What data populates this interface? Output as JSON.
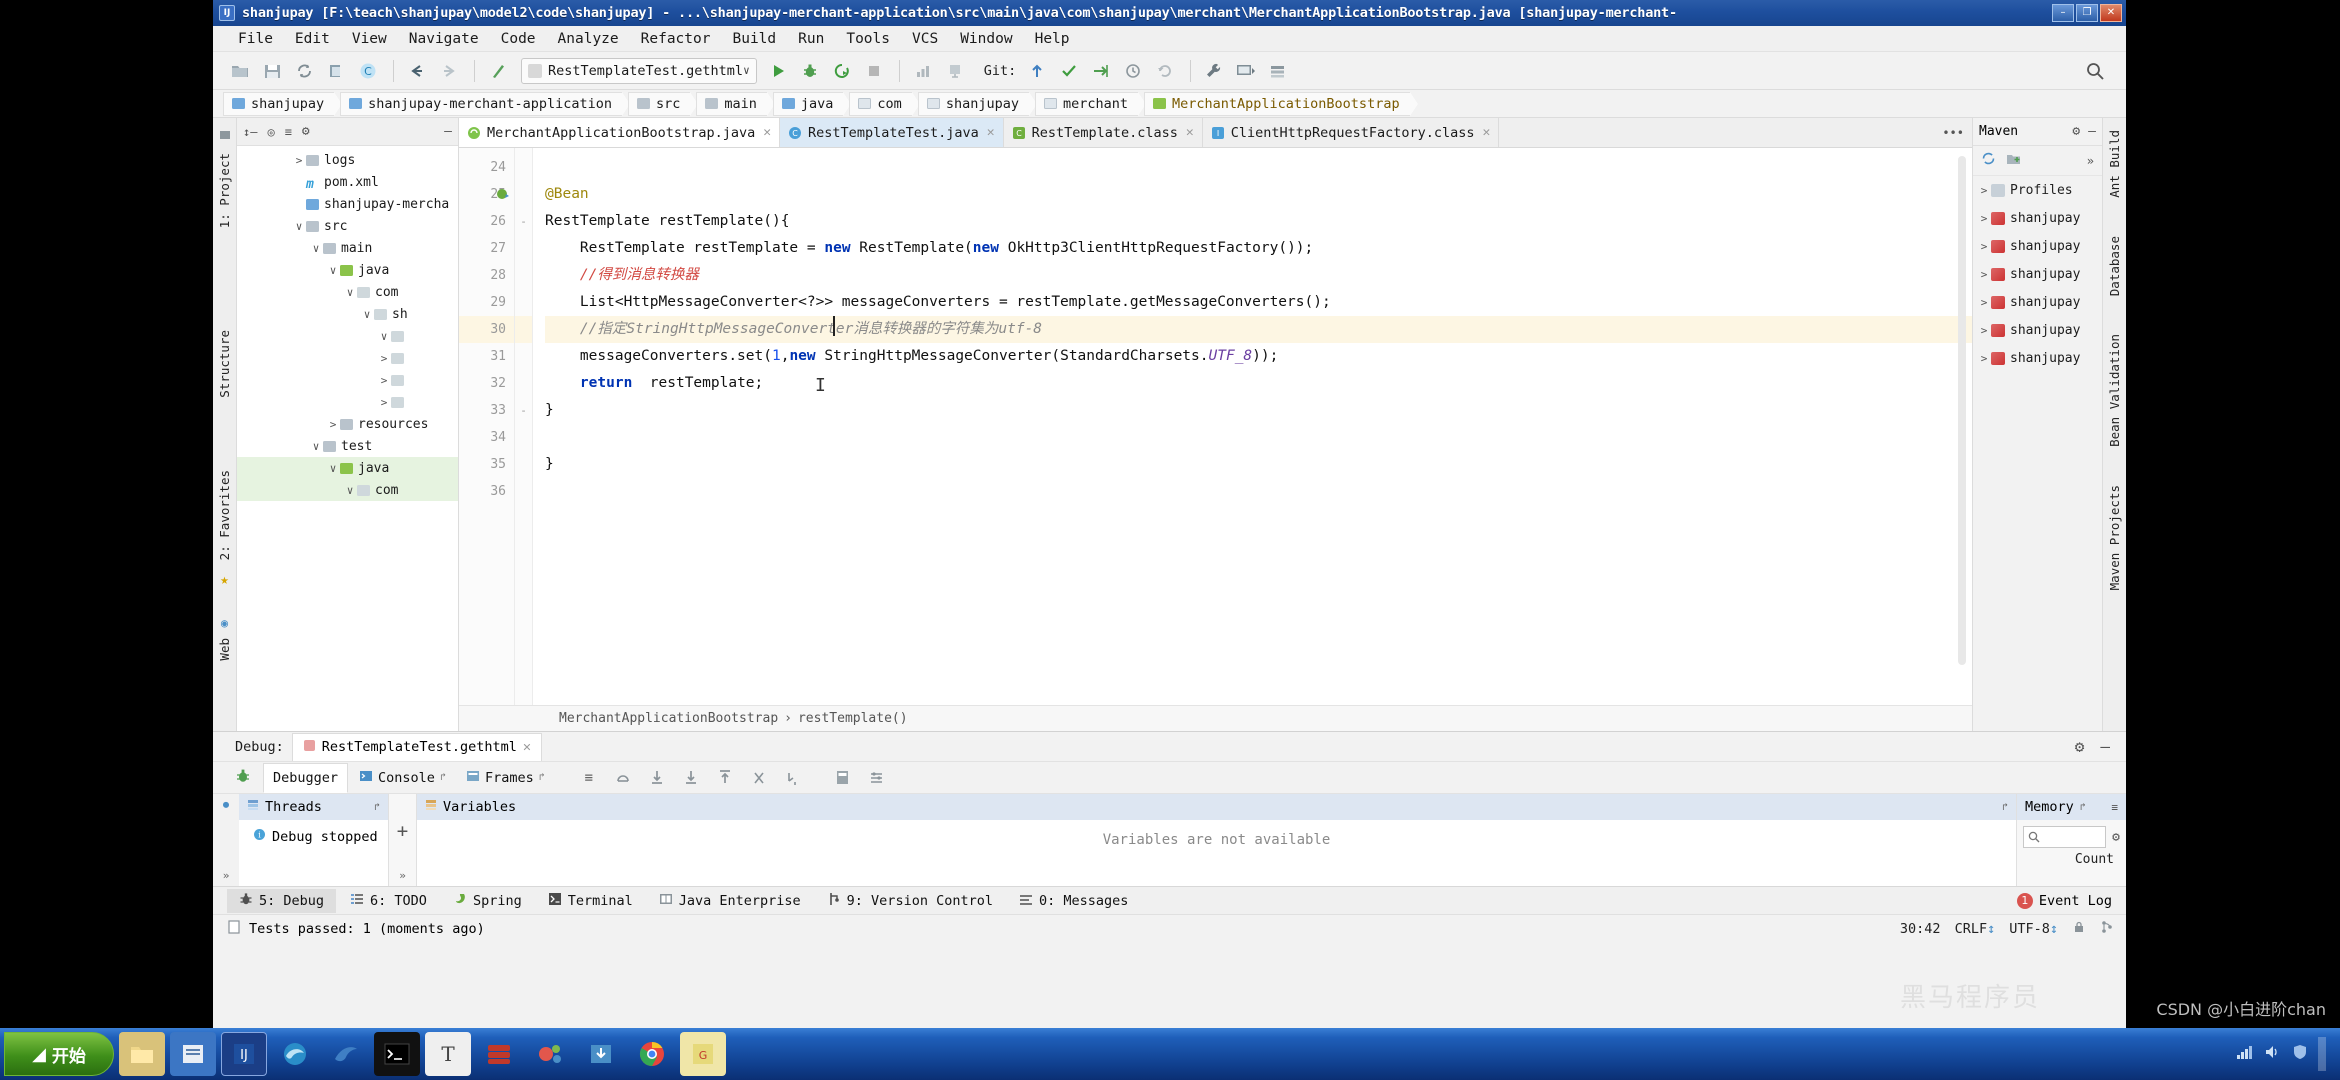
{
  "window": {
    "title": "shanjupay [F:\\teach\\shanjupay\\model2\\code\\shanjupay] - ...\\shanjupay-merchant-application\\src\\main\\java\\com\\shanjupay\\merchant\\MerchantApplicationBootstrap.java [shanjupay-merchant-",
    "app_icon": "idea-icon",
    "minimize": "–",
    "maximize": "❐",
    "close": "✕"
  },
  "menu": {
    "items": [
      "File",
      "Edit",
      "View",
      "Navigate",
      "Code",
      "Analyze",
      "Refactor",
      "Build",
      "Run",
      "Tools",
      "VCS",
      "Window",
      "Help"
    ]
  },
  "toolbar": {
    "icons": [
      "open-folder-icon",
      "save-all-icon",
      "sync-icon",
      "copy-icon",
      "compile-icon",
      "back-arrow-icon",
      "forward-arrow-icon",
      "build-icon"
    ],
    "run_config": {
      "label": "RestTemplateTest.gethtml",
      "chevron": "∨"
    },
    "run_icon": "run-icon",
    "debug_icon": "debug-icon",
    "rerun_icon": "rerun-coverage-icon",
    "stop_icon": "stop-icon",
    "profile_icon": "profiler-icon",
    "attach_icon": "attach-debugger-icon",
    "git_label": "Git:",
    "git_icons": [
      "update-project-icon",
      "commit-icon",
      "push-icon",
      "history-icon",
      "rollback-icon"
    ],
    "extra_icons": [
      "wrench-icon",
      "presentation-icon",
      "stack-icon"
    ],
    "search_icon": "search-icon"
  },
  "breadcrumbs": [
    {
      "label": "shanjupay",
      "icon": "module-icon"
    },
    {
      "label": "shanjupay-merchant-application",
      "icon": "module-icon"
    },
    {
      "label": "src",
      "icon": "folder-icon"
    },
    {
      "label": "main",
      "icon": "folder-icon"
    },
    {
      "label": "java",
      "icon": "source-folder-icon"
    },
    {
      "label": "com",
      "icon": "package-icon"
    },
    {
      "label": "shanjupay",
      "icon": "package-icon"
    },
    {
      "label": "merchant",
      "icon": "package-icon"
    },
    {
      "label": "MerchantApplicationBootstrap",
      "icon": "class-icon"
    }
  ],
  "left_strips": {
    "outer": [
      "1: Project",
      "Structure",
      "2: Favorites",
      "Web"
    ],
    "icons": [
      "project-icon",
      "structure-icon",
      "favorites-star-icon",
      "web-icon"
    ]
  },
  "project_panel": {
    "header_icons": [
      "collapse-icon",
      "target-icon",
      "sort-icon",
      "gear-icon",
      "hide-icon"
    ],
    "tree": [
      {
        "label": "logs",
        "indent": 3,
        "arrow": ">",
        "icon": "folder-icon",
        "selected": false
      },
      {
        "label": "pom.xml",
        "indent": 3,
        "arrow": "",
        "icon": "maven-icon",
        "selected": false
      },
      {
        "label": "shanjupay-mercha",
        "indent": 3,
        "arrow": "",
        "icon": "module-icon",
        "selected": false
      },
      {
        "label": "src",
        "indent": 3,
        "arrow": "∨",
        "icon": "folder-icon",
        "selected": false
      },
      {
        "label": "main",
        "indent": 4,
        "arrow": "∨",
        "icon": "folder-icon",
        "selected": false
      },
      {
        "label": "java",
        "indent": 5,
        "arrow": "∨",
        "icon": "source-folder-icon",
        "selected": false
      },
      {
        "label": "com",
        "indent": 6,
        "arrow": "∨",
        "icon": "package-icon",
        "selected": false
      },
      {
        "label": "sh",
        "indent": 7,
        "arrow": "∨",
        "icon": "package-icon",
        "selected": false
      },
      {
        "label": "",
        "indent": 8,
        "arrow": "∨",
        "icon": "package-icon",
        "selected": false
      },
      {
        "label": "",
        "indent": 8,
        "arrow": ">",
        "icon": "package-icon",
        "selected": false
      },
      {
        "label": "",
        "indent": 8,
        "arrow": ">",
        "icon": "package-icon",
        "selected": false
      },
      {
        "label": "",
        "indent": 8,
        "arrow": ">",
        "icon": "package-icon",
        "selected": false
      },
      {
        "label": "resources",
        "indent": 5,
        "arrow": ">",
        "icon": "resource-folder-icon",
        "selected": false
      },
      {
        "label": "test",
        "indent": 4,
        "arrow": "∨",
        "icon": "folder-icon",
        "selected": false
      },
      {
        "label": "java",
        "indent": 5,
        "arrow": "∨",
        "icon": "test-source-icon",
        "selected": true
      },
      {
        "label": "com",
        "indent": 6,
        "arrow": "∨",
        "icon": "package-icon",
        "selected": true
      }
    ]
  },
  "editor": {
    "tabs": [
      {
        "label": "MerchantApplicationBootstrap.java",
        "icon": "spring-class-icon",
        "state": "active",
        "close": "✕"
      },
      {
        "label": "RestTemplateTest.java",
        "icon": "class-icon",
        "state": "selected",
        "close": "✕"
      },
      {
        "label": "RestTemplate.class",
        "icon": "class-file-icon",
        "state": "normal",
        "close": "✕"
      },
      {
        "label": "ClientHttpRequestFactory.class",
        "icon": "interface-file-icon",
        "state": "normal",
        "close": "✕"
      }
    ],
    "tab_overflow_icon": "tab-list-icon",
    "first_line_number": 24,
    "lines": [
      {
        "n": 24,
        "tokens": [],
        "highlight": false,
        "gutter_icon": ""
      },
      {
        "n": 25,
        "tokens": [
          {
            "t": "@Bean",
            "c": "ann"
          }
        ],
        "highlight": false,
        "gutter_icon": "spring-bean-icon"
      },
      {
        "n": 26,
        "tokens": [
          {
            "t": "RestTemplate restTemplate(){",
            "c": ""
          }
        ],
        "highlight": false,
        "fold": "-"
      },
      {
        "n": 27,
        "tokens": [
          {
            "t": "    RestTemplate restTemplate = ",
            "c": ""
          },
          {
            "t": "new",
            "c": "kw"
          },
          {
            "t": " RestTemplate(",
            "c": ""
          },
          {
            "t": "new",
            "c": "kw"
          },
          {
            "t": " OkHttp3ClientHttpRequestFactory());",
            "c": ""
          }
        ],
        "highlight": false
      },
      {
        "n": 28,
        "tokens": [
          {
            "t": "    //得到消息转换器",
            "c": "cmt"
          }
        ],
        "highlight": false
      },
      {
        "n": 29,
        "tokens": [
          {
            "t": "    List<HttpMessageConverter<?>> messageConverters = restTemplate.getMessageConverters();",
            "c": ""
          }
        ],
        "highlight": false
      },
      {
        "n": 30,
        "tokens": [
          {
            "t": "    //指定",
            "c": "cmt-i"
          },
          {
            "t": "StringHttpMessageConverter",
            "c": "cmt-i"
          },
          {
            "t": "消息转换器的字符集为",
            "c": "cmt-i"
          },
          {
            "t": "utf-8",
            "c": "cmt-i"
          }
        ],
        "highlight": true
      },
      {
        "n": 31,
        "tokens": [
          {
            "t": "    messageConverters.set(",
            "c": ""
          },
          {
            "t": "1",
            "c": "num"
          },
          {
            "t": ",",
            "c": ""
          },
          {
            "t": "new",
            "c": "kw"
          },
          {
            "t": " StringHttpMessageConverter(StandardCharsets.",
            "c": ""
          },
          {
            "t": "UTF_8",
            "c": "fld"
          },
          {
            "t": "));",
            "c": ""
          }
        ],
        "highlight": false
      },
      {
        "n": 32,
        "tokens": [
          {
            "t": "    ",
            "c": ""
          },
          {
            "t": "return",
            "c": "kw"
          },
          {
            "t": "  restTemplate;",
            "c": ""
          }
        ],
        "highlight": false
      },
      {
        "n": 33,
        "tokens": [
          {
            "t": "}",
            "c": ""
          }
        ],
        "highlight": false,
        "fold": "-"
      },
      {
        "n": 34,
        "tokens": [],
        "highlight": false
      },
      {
        "n": 35,
        "tokens": [
          {
            "t": "}",
            "c": ""
          }
        ],
        "highlight": false
      },
      {
        "n": 36,
        "tokens": [],
        "highlight": false
      }
    ],
    "breadcrumb_bottom": [
      "MerchantApplicationBootstrap",
      "restTemplate()"
    ],
    "breadcrumb_sep": "›"
  },
  "maven_panel": {
    "title": "Maven",
    "gear_icon": "gear-icon",
    "minimize_icon": "—",
    "toolbar_icons": [
      "refresh-icon",
      "add-maven-project-icon",
      "expand-icon"
    ],
    "rows": [
      {
        "label": "Profiles",
        "arrow": ">",
        "icon": "profiles-folder-icon"
      },
      {
        "label": "shanjupay",
        "arrow": ">",
        "icon": "maven-module-icon"
      },
      {
        "label": "shanjupay",
        "arrow": ">",
        "icon": "maven-module-icon"
      },
      {
        "label": "shanjupay",
        "arrow": ">",
        "icon": "maven-module-icon"
      },
      {
        "label": "shanjupay",
        "arrow": ">",
        "icon": "maven-module-icon"
      },
      {
        "label": "shanjupay",
        "arrow": ">",
        "icon": "maven-module-icon"
      },
      {
        "label": "shanjupay",
        "arrow": ">",
        "icon": "maven-module-icon"
      }
    ]
  },
  "right_strips": {
    "labels": [
      "Ant Build",
      "Database",
      "Bean Validation",
      "Maven Projects"
    ]
  },
  "debug": {
    "label": "Debug:",
    "session_tab": {
      "label": "RestTemplateTest.gethtml",
      "icon": "test-icon",
      "close": "✕"
    },
    "gear_icon": "gear-icon",
    "minimize_icon": "—",
    "tabs": [
      {
        "label": "Debugger",
        "icon": "",
        "active": true
      },
      {
        "label": "Console",
        "icon": "console-icon",
        "active": false,
        "pin": "↱"
      },
      {
        "label": "Frames",
        "icon": "frames-icon",
        "active": false,
        "pin": "↱"
      }
    ],
    "tool_icons": [
      "mute-breakpoints-icon",
      "step-over-icon",
      "step-into-icon",
      "force-step-into-icon",
      "step-out-icon",
      "drop-frame-icon",
      "run-to-cursor-icon",
      "evaluate-icon",
      "settings-icon"
    ],
    "threads": {
      "title": "Threads",
      "icon": "threads-icon",
      "pin": "↱",
      "item": "Debug stopped",
      "item_icon": "info-icon",
      "add_icon": "+",
      "more": "»"
    },
    "variables": {
      "title": "Variables",
      "icon": "variables-icon",
      "message": "Variables are not available",
      "pin": "↱"
    },
    "memory": {
      "title": "Memory",
      "pin": "↱",
      "menu_icon": "≡",
      "search_icon": "search-icon",
      "gear_icon": "gear-icon",
      "count_label": "Count"
    }
  },
  "bottom_tabs": [
    {
      "label": "5: Debug",
      "icon": "debug-icon",
      "active": true
    },
    {
      "label": "6: TODO",
      "icon": "todo-icon",
      "active": false
    },
    {
      "label": "Spring",
      "icon": "spring-icon",
      "active": false
    },
    {
      "label": "Terminal",
      "icon": "terminal-icon",
      "active": false
    },
    {
      "label": "Java Enterprise",
      "icon": "java-ee-icon",
      "active": false
    },
    {
      "label": "9: Version Control",
      "icon": "vcs-icon",
      "active": false
    },
    {
      "label": "0: Messages",
      "icon": "messages-icon",
      "active": false
    }
  ],
  "event_log": {
    "label": "Event Log",
    "badge": "1"
  },
  "status_bar": {
    "icon": "test-status-icon",
    "message": "Tests passed: 1 (moments ago)",
    "caret": "30:42",
    "line_sep": "CRLF",
    "line_sep_arrow": "↕",
    "encoding": "UTF-8",
    "encoding_arrow": "↕",
    "lock_icon": "lock-icon",
    "tree_icon": "branch-icon"
  },
  "taskbar": {
    "start_label": "开始",
    "items": [
      "explorer-icon",
      "files-icon",
      "idea-icon",
      "edge-icon",
      "dolphin-icon",
      "cmd-icon",
      "typora-icon",
      "database-icon",
      "xmind-icon",
      "downloads-icon",
      "chrome-icon",
      "pdf-icon"
    ],
    "tray_time": "",
    "tray_icons": [
      "network-icon",
      "volume-icon",
      "shield-icon",
      "show-desktop"
    ]
  },
  "watermark": "黑马程序员",
  "credit": "CSDN @小白进阶chan",
  "colors": {
    "title_blue": "#1e4f9e",
    "accent_green": "#59a869",
    "highlight_line": "#fdf6e3",
    "selection_green": "#e6f3e0",
    "header_blue": "#dde6f2"
  }
}
